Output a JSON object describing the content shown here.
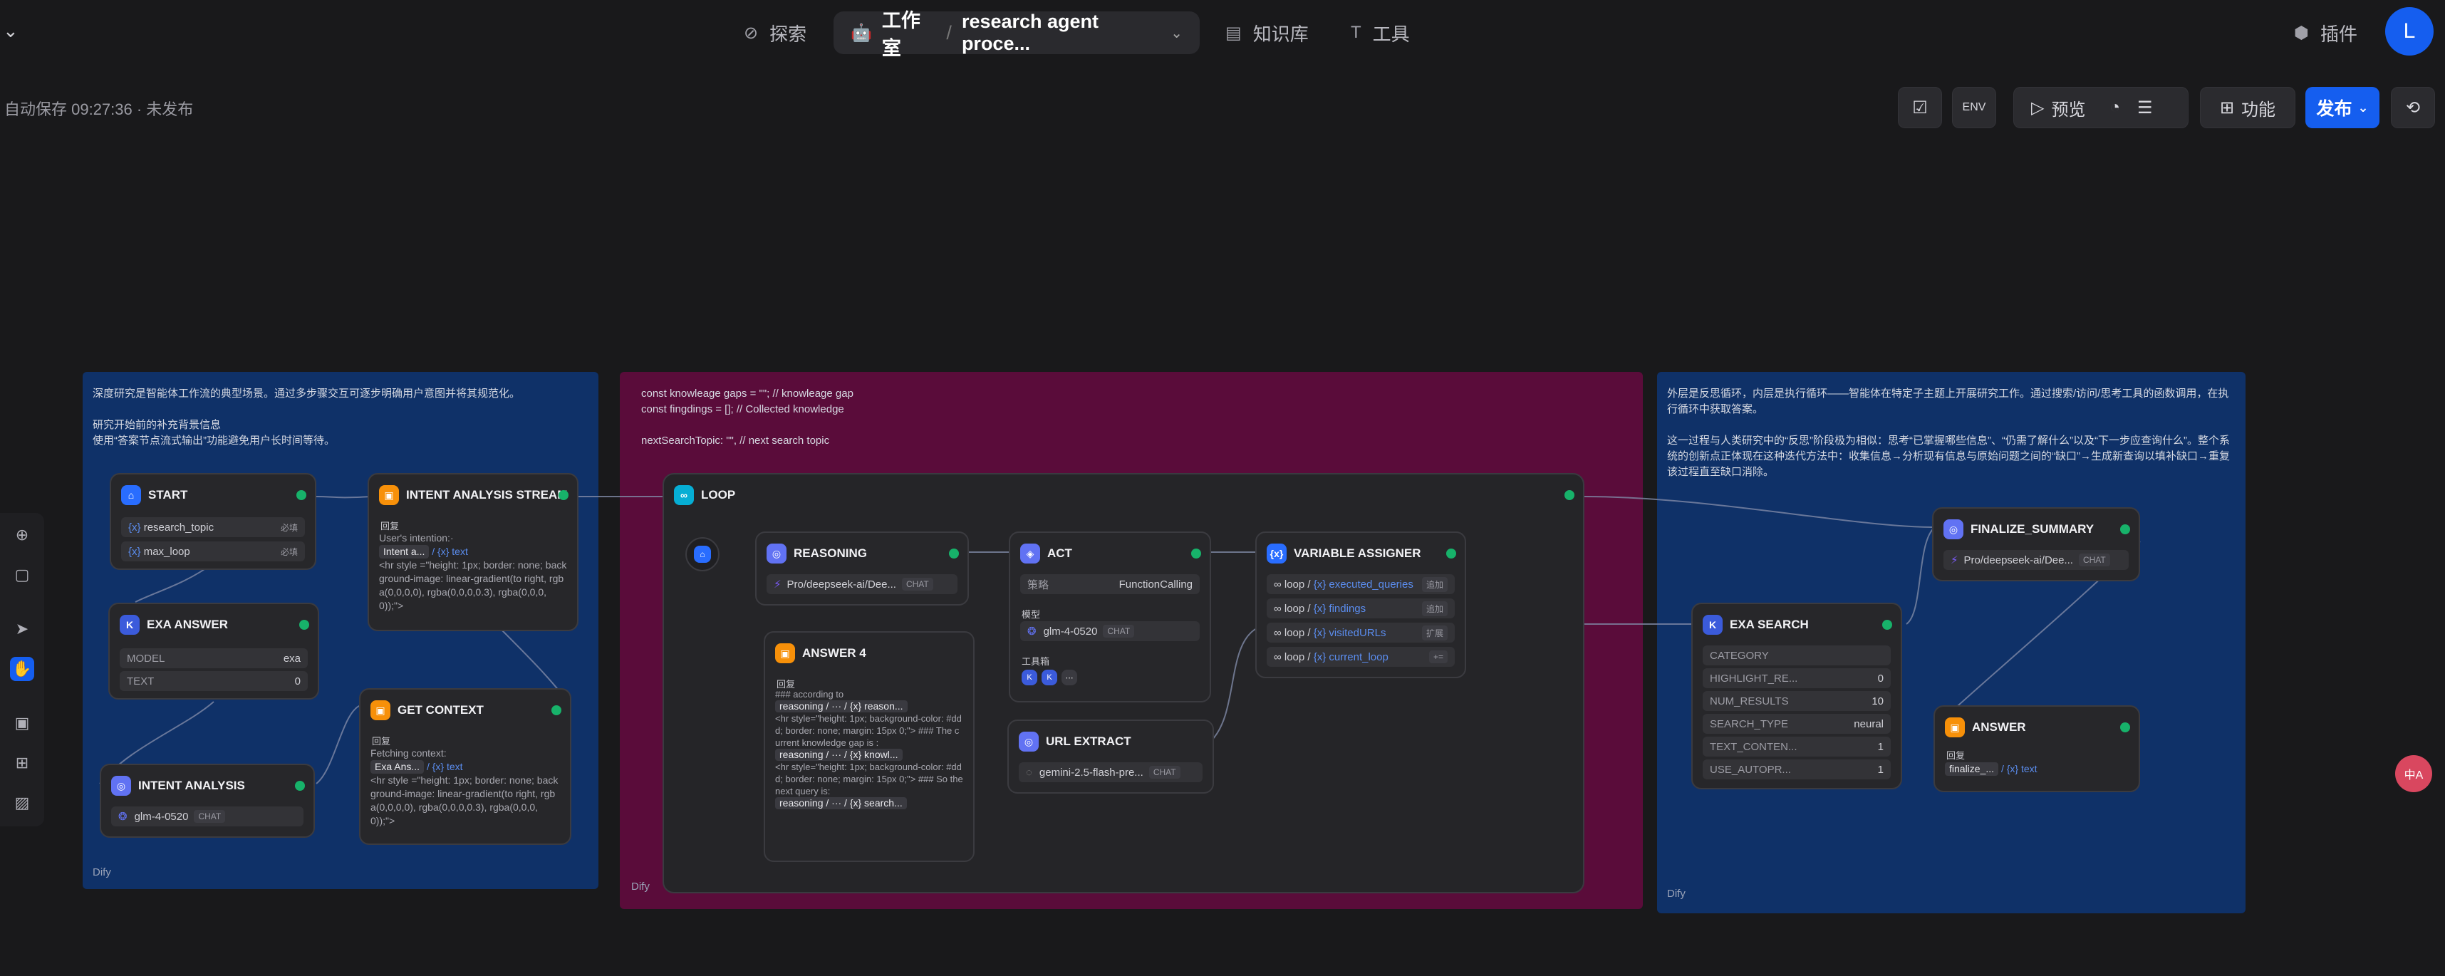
{
  "topbar": {
    "nav_explore": "探索",
    "studio": "工作室",
    "app_name": "research agent proce...",
    "nav_knowledge": "知识库",
    "nav_tools": "工具",
    "plugins": "插件",
    "avatar_initial": "L"
  },
  "toolbar": {
    "autosave": "自动保存 09:27:36 · 未发布",
    "preview": "预览",
    "features": "功能",
    "publish": "发布"
  },
  "frames": {
    "left_note": "深度研究是智能体工作流的典型场景。通过多步骤交互可逐步明确用户意图并将其规范化。\n\n研究开始前的补充背景信息\n使用“答案节点流式输出”功能避免用户长时间等待。",
    "middle_note": "const knowleage gaps = \"\";       // knowleage gap\nconst fingdings = [];       // Collected knowledge\n\nnextSearchTopic: \"\",         // next search topic",
    "right_note": "外层是反思循环，内层是执行循环——智能体在特定子主题上开展研究工作。通过搜索/访问/思考工具的函数调用，在执行循环中获取答案。\n\n这一过程与人类研究中的“反思”阶段极为相似：思考“已掌握哪些信息”、“仍需了解什么”以及“下一步应查询什么”。整个系统的创新点正体现在这种迭代方法中：收集信息→分析现有信息与原始问题之间的“缺口”→生成新查询以填补缺口→重复该过程直至缺口消除。",
    "brand": "Dify"
  },
  "nodes": {
    "start": {
      "title": "START",
      "var1": "research_topic",
      "var2": "max_loop",
      "req": "必填"
    },
    "exa_answer": {
      "title": "EXA ANSWER",
      "k1": "MODEL",
      "v1": "exa",
      "k2": "TEXT",
      "v2": "0"
    },
    "intent_analysis": {
      "title": "INTENT ANALYSIS",
      "model": "glm-4-0520",
      "mode": "CHAT"
    },
    "intent_stream": {
      "title": "INTENT ANALYSIS STREAM",
      "label": "回复",
      "text1": "User's intention:·",
      "chip": "Intent a...",
      "var": "/ {x} text",
      "text2": "<hr style =\"height: 1px; border: none; background-image: linear-gradient(to right, rgba(0,0,0,0), rgba(0,0,0,0.3), rgba(0,0,0,0));\">"
    },
    "get_context": {
      "title": "GET CONTEXT",
      "label": "回复",
      "text1": "Fetching context:",
      "chip": "Exa Ans...",
      "var": "/ {x} text",
      "text2": "<hr style =\"height: 1px; border: none; background-image: linear-gradient(to right, rgba(0,0,0,0), rgba(0,0,0,0.3), rgba(0,0,0,0));\">"
    },
    "loop": {
      "title": "LOOP"
    },
    "reasoning": {
      "title": "REASONING",
      "model": "Pro/deepseek-ai/Dee...",
      "mode": "CHAT"
    },
    "answer4": {
      "title": "ANSWER 4",
      "label": "回复",
      "t1": "### according to",
      "c1": "reasoning / ··· / {x} reason...",
      "t2": "<hr style=\"height: 1px; background-color: #ddd; border: none; margin: 15px 0;\"> ### The current knowledge gap is :",
      "c2": "reasoning / ··· / {x} knowl...",
      "t3": "<hr style=\"height: 1px; background-color: #ddd; border: none; margin: 15px 0;\"> ### So the next query is:",
      "c3": "reasoning / ··· / {x} search..."
    },
    "act": {
      "title": "ACT",
      "strategy_k": "策略",
      "strategy_v": "FunctionCalling",
      "model_label": "模型",
      "model": "glm-4-0520",
      "mode": "CHAT",
      "tools_label": "工具箱"
    },
    "url_extract": {
      "title": "URL EXTRACT",
      "model": "gemini-2.5-flash-pre...",
      "mode": "CHAT"
    },
    "var_assigner": {
      "title": "VARIABLE ASSIGNER",
      "rows": [
        {
          "p": "loop /",
          "v": "{x} executed_queries",
          "op": "追加"
        },
        {
          "p": "loop /",
          "v": "{x} findings",
          "op": "追加"
        },
        {
          "p": "loop /",
          "v": "{x} visitedURLs",
          "op": "扩展"
        },
        {
          "p": "loop /",
          "v": "{x} current_loop",
          "op": "+="
        }
      ]
    },
    "exa_search": {
      "title": "EXA SEARCH",
      "rows": [
        {
          "k": "CATEGORY",
          "v": ""
        },
        {
          "k": "HIGHLIGHT_RE...",
          "v": "0"
        },
        {
          "k": "NUM_RESULTS",
          "v": "10"
        },
        {
          "k": "SEARCH_TYPE",
          "v": "neural"
        },
        {
          "k": "TEXT_CONTEN...",
          "v": "1"
        },
        {
          "k": "USE_AUTOPR...",
          "v": "1"
        }
      ]
    },
    "finalize": {
      "title": "FINALIZE_SUMMARY",
      "model": "Pro/deepseek-ai/Dee...",
      "mode": "CHAT"
    },
    "answer": {
      "title": "ANSWER",
      "label": "回复",
      "chip": "finalize_...",
      "var": "/ {x} text"
    }
  },
  "colors": {
    "accent": "#155eef",
    "ok": "#17b26a",
    "frame_blue": "#0f3168",
    "frame_magenta": "#5a0c3a"
  }
}
